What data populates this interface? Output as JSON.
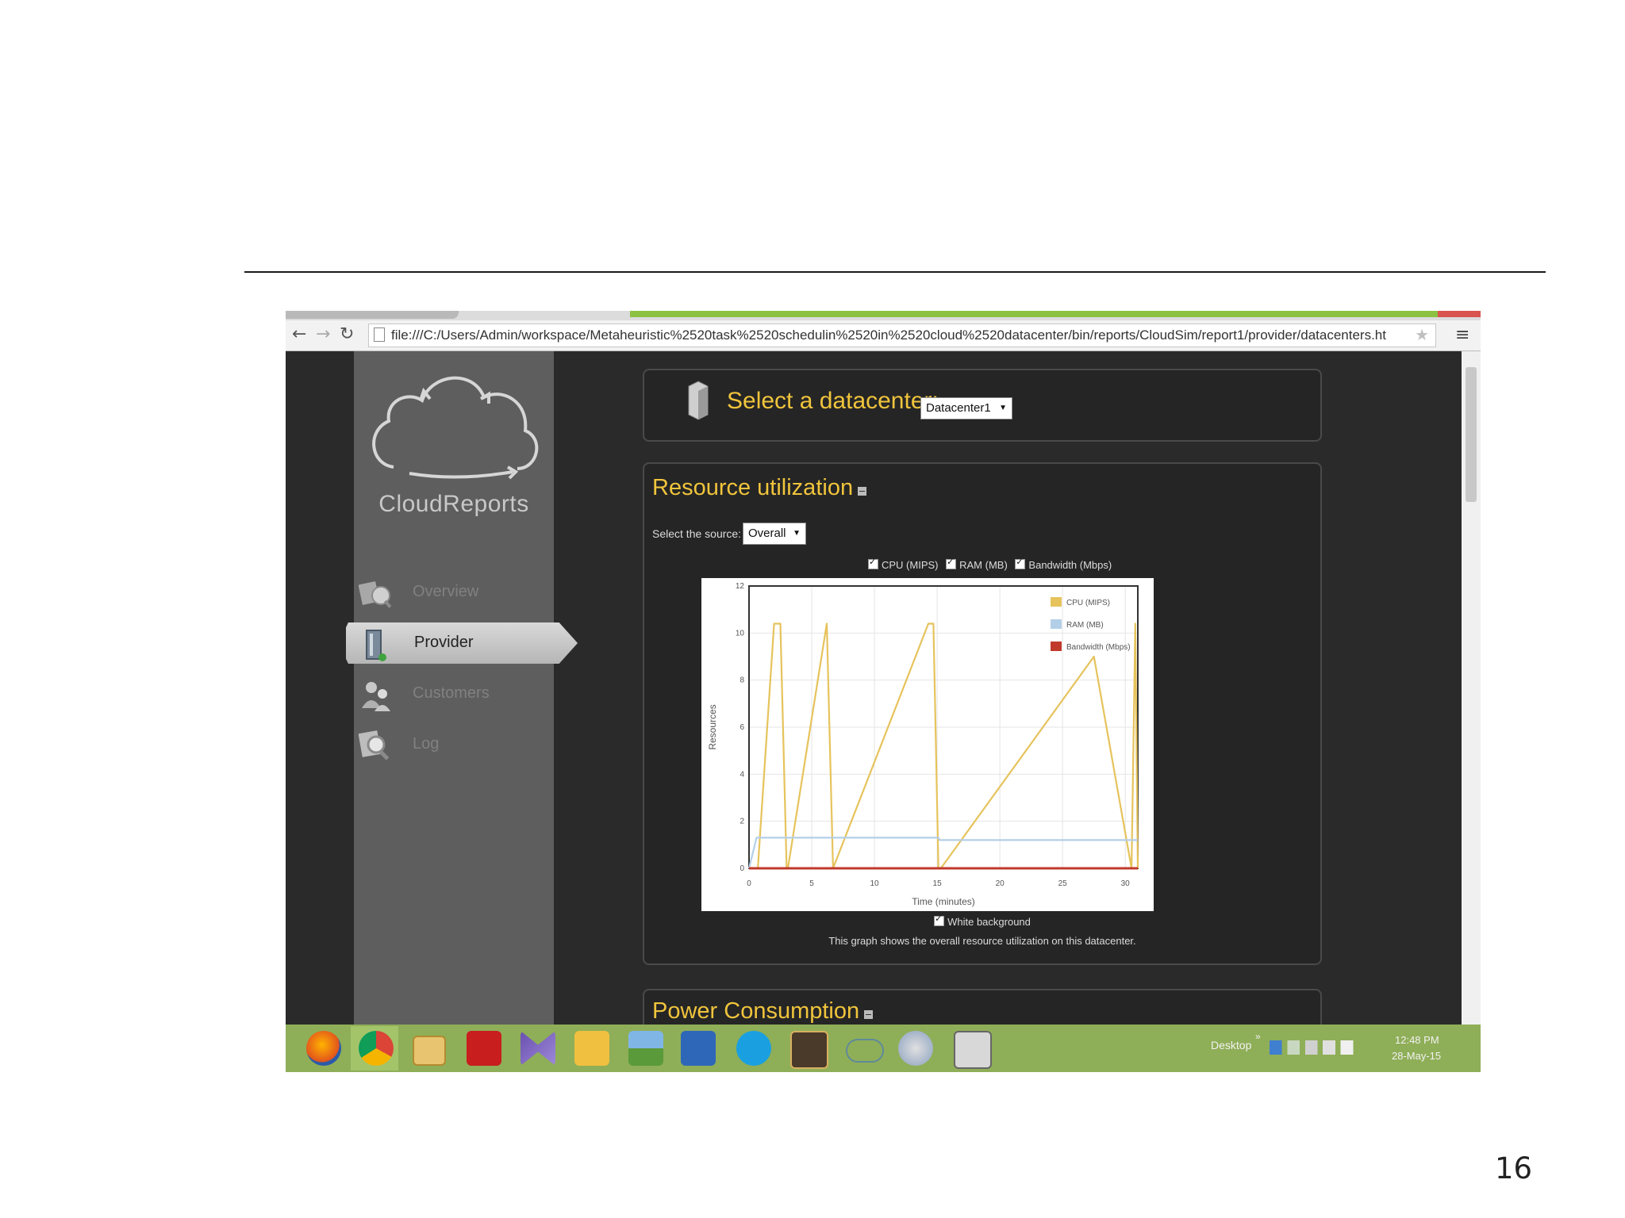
{
  "browser": {
    "url": "file:///C:/Users/Admin/workspace/Metaheuristic%2520task%2520schedulin%2520in%2520cloud%2520datacenter/bin/reports/CloudSim/report1/provider/datacenters.ht"
  },
  "app": {
    "logo_text": "CloudReports",
    "nav": [
      {
        "label": "Overview",
        "active": false
      },
      {
        "label": "Provider",
        "active": true
      },
      {
        "label": "Customers",
        "active": false
      },
      {
        "label": "Log",
        "active": false
      }
    ]
  },
  "datacenter_panel": {
    "title": "Select a datacenter:",
    "selected": "Datacenter1"
  },
  "resource_panel": {
    "title": "Resource utilization",
    "source_label": "Select the source:",
    "source_selected": "Overall",
    "series_toggles": [
      "CPU (MIPS)",
      "RAM (MB)",
      "Bandwidth (Mbps)"
    ],
    "white_bg_label": "White background",
    "caption": "This graph shows the overall resource utilization on this datacenter."
  },
  "power_panel": {
    "title": "Power Consumption"
  },
  "taskbar": {
    "desktop_label": "Desktop",
    "time": "12:48 PM",
    "date": "28-May-15"
  },
  "slide_number": "16",
  "colors": {
    "accent_yellow": "#f0c43c",
    "taskbar_green": "#8fae58",
    "cpu": "#e6c35c",
    "ram": "#b3cfe8",
    "bandwidth": "#c0392b"
  },
  "chart_data": {
    "type": "line",
    "xlabel": "Time (minutes)",
    "ylabel": "Resources",
    "xlim": [
      0,
      31
    ],
    "ylim": [
      0,
      12
    ],
    "xticks": [
      0,
      5,
      10,
      15,
      20,
      25,
      30
    ],
    "yticks": [
      0,
      2,
      4,
      6,
      8,
      10,
      12
    ],
    "grid": true,
    "legend_position": "top-right",
    "series": [
      {
        "name": "CPU (MIPS)",
        "color": "#e6c35c",
        "points": [
          [
            0,
            0
          ],
          [
            0.7,
            0
          ],
          [
            2,
            10.4
          ],
          [
            2.5,
            10.4
          ],
          [
            3,
            0
          ],
          [
            3.1,
            0
          ],
          [
            6.2,
            10.4
          ],
          [
            6.7,
            0
          ],
          [
            14.3,
            10.4
          ],
          [
            14.7,
            10.4
          ],
          [
            15.1,
            0
          ],
          [
            15.3,
            0
          ],
          [
            27.5,
            9
          ],
          [
            30.5,
            0
          ],
          [
            30.8,
            10.4
          ],
          [
            31,
            0
          ]
        ]
      },
      {
        "name": "RAM (MB)",
        "color": "#b3cfe8",
        "points": [
          [
            0,
            0
          ],
          [
            0.6,
            1.3
          ],
          [
            15.1,
            1.3
          ],
          [
            15.2,
            1.2
          ],
          [
            31,
            1.2
          ]
        ]
      },
      {
        "name": "Bandwidth (Mbps)",
        "color": "#c0392b",
        "points": [
          [
            0,
            0
          ],
          [
            31,
            0
          ]
        ]
      }
    ]
  }
}
